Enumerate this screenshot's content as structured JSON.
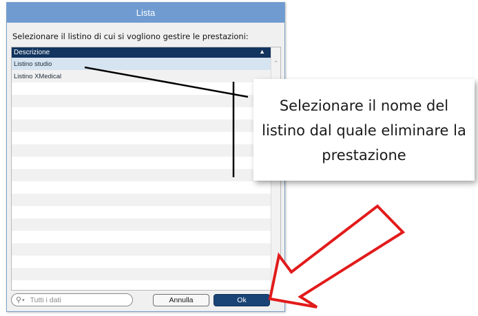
{
  "window": {
    "title": "Lista"
  },
  "instruction": "Selezionare il listino di cui si vogliono gestire le prestazioni:",
  "list": {
    "header": "Descrizione",
    "sort_icon": "sort-ascending-icon",
    "rows": [
      {
        "label": "Listino studio",
        "selected": true
      },
      {
        "label": "Listino XMedical",
        "selected": false
      }
    ]
  },
  "search": {
    "placeholder": "Tutti i dati",
    "icon": "search-icon"
  },
  "buttons": {
    "cancel": "Annulla",
    "ok": "Ok"
  },
  "callout": {
    "text": "Selezionare il nome del listino dal quale eliminare la prestazione"
  },
  "colors": {
    "titlebar": "#6f9bd1",
    "header": "#12355f",
    "ok_button": "#1a4476",
    "arrow": "#e21b1b"
  }
}
